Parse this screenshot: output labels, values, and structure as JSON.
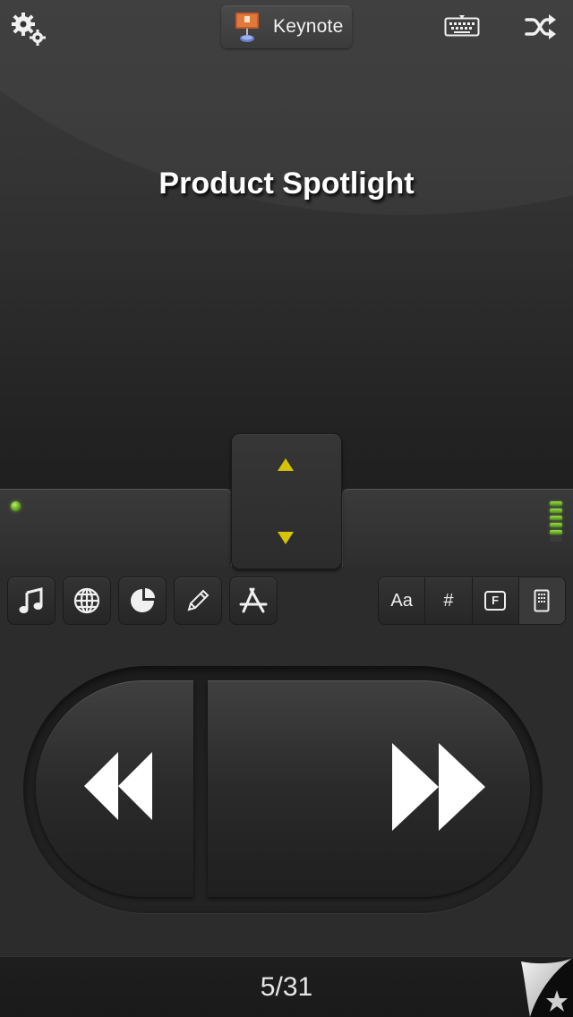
{
  "header": {
    "app_name": "Keynote",
    "settings_icon": "gears-icon",
    "keyboard_icon": "keyboard-icon",
    "shuffle_icon": "shuffle-icon"
  },
  "slide": {
    "title": "Product Spotlight"
  },
  "toolbar": {
    "tools": [
      "music-icon",
      "globe-icon",
      "pie-chart-icon",
      "pencil-icon",
      "app-store-icon"
    ],
    "segments": {
      "font_label": "Aa",
      "number_label": "#",
      "f_label": "F",
      "notes_icon": "notes-icon"
    }
  },
  "navigation": {
    "prev_icon": "rewind-icon",
    "next_icon": "fast-forward-icon"
  },
  "status": {
    "page_counter": "5/31",
    "level_meter_active": 5,
    "level_meter_total": 6
  },
  "colors": {
    "accent_arrow": "#d7c400",
    "led_green": "#7ccc2c",
    "text": "#ffffff"
  }
}
